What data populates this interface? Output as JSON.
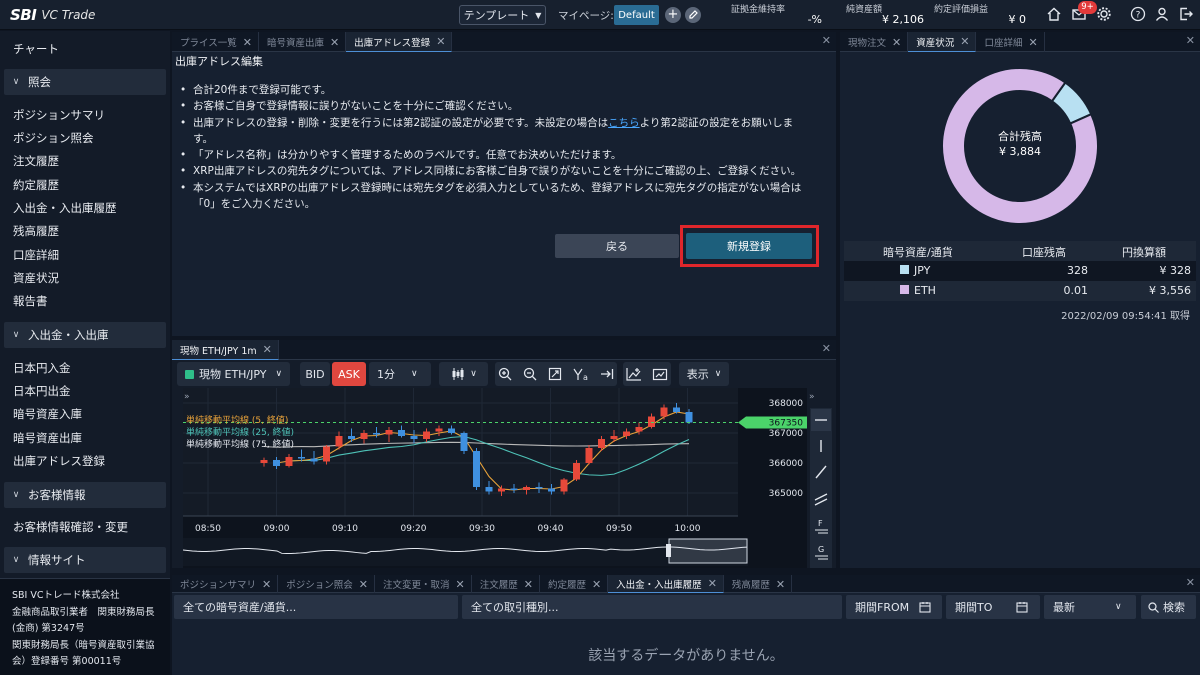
{
  "app": {
    "brand_main": "SBI",
    "brand_sub": "VC Trade"
  },
  "topbar": {
    "template_label": "テンプレート",
    "mypage_label": "マイページ:",
    "default_label": "Default",
    "stats": [
      {
        "label": "証拠金維持率",
        "value": "-%"
      },
      {
        "label": "純資産額",
        "value": "¥ 2,106"
      },
      {
        "label": "約定評価損益",
        "value": "¥ 0"
      }
    ],
    "notification_badge": "9+"
  },
  "sidebar": {
    "top_item": "チャート",
    "sections": [
      {
        "title": "照会",
        "items": [
          "ポジションサマリ",
          "ポジション照会",
          "注文履歴",
          "約定履歴",
          "入出金・入出庫履歴",
          "残高履歴",
          "口座詳細",
          "資産状況",
          "報告書"
        ]
      },
      {
        "title": "入出金・入出庫",
        "items": [
          "日本円入金",
          "日本円出金",
          "暗号資産入庫",
          "暗号資産出庫",
          "出庫アドレス登録"
        ]
      },
      {
        "title": "お客様情報",
        "items": [
          "お客様情報確認・変更"
        ]
      },
      {
        "title": "情報サイト",
        "items": []
      }
    ],
    "company": [
      "SBI VCトレード株式会社",
      "金融商品取引業者　関東財務局長",
      "(金商) 第3247号",
      "関東財務局長（暗号資産取引業協",
      "会）登録番号 第00011号"
    ]
  },
  "main_panel": {
    "tabs": [
      "プライス一覧",
      "暗号資産出庫",
      "出庫アドレス登録"
    ],
    "active_tab": 2,
    "heading": "出庫アドレス編集",
    "notes": [
      "合計20件まで登録可能です。",
      "お客様ご自身で登録情報に誤りがないことを十分にご確認ください。",
      {
        "before": "出庫アドレスの登録・削除・変更を行うには第2認証の設定が必要です。未設定の場合は",
        "link": "こちら",
        "after": "より第2認証の設定をお願いしま"
      },
      "す。",
      "「アドレス名称」は分かりやすく管理するためのラベルです。任意でお決めいただけます。",
      "XRP出庫アドレスの宛先タグについては、アドレス同様にお客様ご自身で誤りがないことを十分にご確認の上、ご登録ください。",
      "本システムではXRPの出庫アドレス登録時には宛先タグを必須入力としているため、登録アドレスに宛先タグの指定がない場合は",
      "「0」をご入力ください。"
    ],
    "back_button": "戻る",
    "register_button": "新規登録"
  },
  "chart_panel": {
    "tab": "現物 ETH/JPY 1m",
    "toolbar": {
      "symbol": "現物 ETH/JPY",
      "bid": "BID",
      "ask": "ASK",
      "interval": "1分",
      "display": "表示"
    },
    "legend": [
      "単純移動平均線 (5, 終値)",
      "単純移動平均線 (25, 終値)",
      "単純移動平均線 (75, 終値)"
    ],
    "price_tag": "367350",
    "colors": {
      "up": "#e8493a",
      "down": "#3f90e0",
      "ma5": "#e8a23a",
      "ma25": "#4ec2b7",
      "ma75": "#b9b9b9",
      "tag": "#4bd36a"
    }
  },
  "chart_data": {
    "type": "candlestick",
    "x_ticks": [
      "08:50",
      "09:00",
      "09:10",
      "09:20",
      "09:30",
      "09:40",
      "09:50",
      "10:00"
    ],
    "y_ticks": [
      368000,
      367000,
      366000,
      365000
    ],
    "ylim": [
      364500,
      368300
    ],
    "current_price": 367350,
    "candles": [
      [
        366000,
        366180,
        365880,
        366100
      ],
      [
        366100,
        366200,
        365800,
        365900
      ],
      [
        365900,
        366300,
        365850,
        366200
      ],
      [
        366200,
        366450,
        366050,
        366150
      ],
      [
        366150,
        366400,
        365950,
        366050
      ],
      [
        366050,
        366600,
        365950,
        366550
      ],
      [
        366550,
        367050,
        366450,
        366900
      ],
      [
        366900,
        367150,
        366700,
        366800
      ],
      [
        366800,
        367100,
        366650,
        367000
      ],
      [
        367000,
        367200,
        366850,
        366950
      ],
      [
        366950,
        367200,
        366700,
        367100
      ],
      [
        367100,
        367250,
        366850,
        366900
      ],
      [
        366900,
        367100,
        366650,
        366800
      ],
      [
        366800,
        367150,
        366700,
        367050
      ],
      [
        367050,
        367250,
        366900,
        367150
      ],
      [
        367150,
        367250,
        366950,
        367000
      ],
      [
        367000,
        367050,
        366300,
        366400
      ],
      [
        366400,
        366500,
        365100,
        365200
      ],
      [
        365200,
        365400,
        364950,
        365050
      ],
      [
        365050,
        365250,
        364900,
        365150
      ],
      [
        365150,
        365300,
        365000,
        365100
      ],
      [
        365100,
        365250,
        364950,
        365200
      ],
      [
        365200,
        365350,
        365000,
        365150
      ],
      [
        365150,
        365300,
        364950,
        365050
      ],
      [
        365050,
        365500,
        364950,
        365450
      ],
      [
        365450,
        366100,
        365400,
        366000
      ],
      [
        366000,
        366600,
        365950,
        366500
      ],
      [
        366500,
        366900,
        366400,
        366800
      ],
      [
        366800,
        367100,
        366700,
        366900
      ],
      [
        366900,
        367150,
        366800,
        367050
      ],
      [
        367050,
        367350,
        366950,
        367200
      ],
      [
        367200,
        367650,
        367150,
        367550
      ],
      [
        367550,
        367950,
        367450,
        367850
      ],
      [
        367850,
        368000,
        367650,
        367700
      ],
      [
        367700,
        367800,
        367300,
        367350
      ]
    ]
  },
  "right_panel": {
    "tabs": [
      "現物注文",
      "資産状況",
      "口座詳細"
    ],
    "active_tab": 1,
    "donut_label": "合計残高",
    "donut_value": "¥ 3,884",
    "table_headers": [
      "暗号資産/通貨",
      "口座残高",
      "円換算額"
    ],
    "rows": [
      {
        "name": "JPY",
        "balance": "328",
        "jpy": "¥ 328",
        "color": "#b8e0f2"
      },
      {
        "name": "ETH",
        "balance": "0.01",
        "jpy": "¥ 3,556",
        "color": "#d6b8e8"
      }
    ],
    "timestamp": "2022/02/09 09:54:41 取得"
  },
  "bottom_panel": {
    "tabs": [
      "ポジションサマリ",
      "ポジション照会",
      "注文変更・取消",
      "注文履歴",
      "約定履歴",
      "入出金・入出庫履歴",
      "残高履歴"
    ],
    "active_tab": 5,
    "filters": {
      "asset_placeholder": "全ての暗号資産/通貨...",
      "type_placeholder": "全ての取引種別...",
      "from_label": "期間FROM",
      "to_label": "期間TO",
      "sort_value": "最新",
      "search_label": "検索"
    },
    "empty_message": "該当するデータがありません。"
  }
}
